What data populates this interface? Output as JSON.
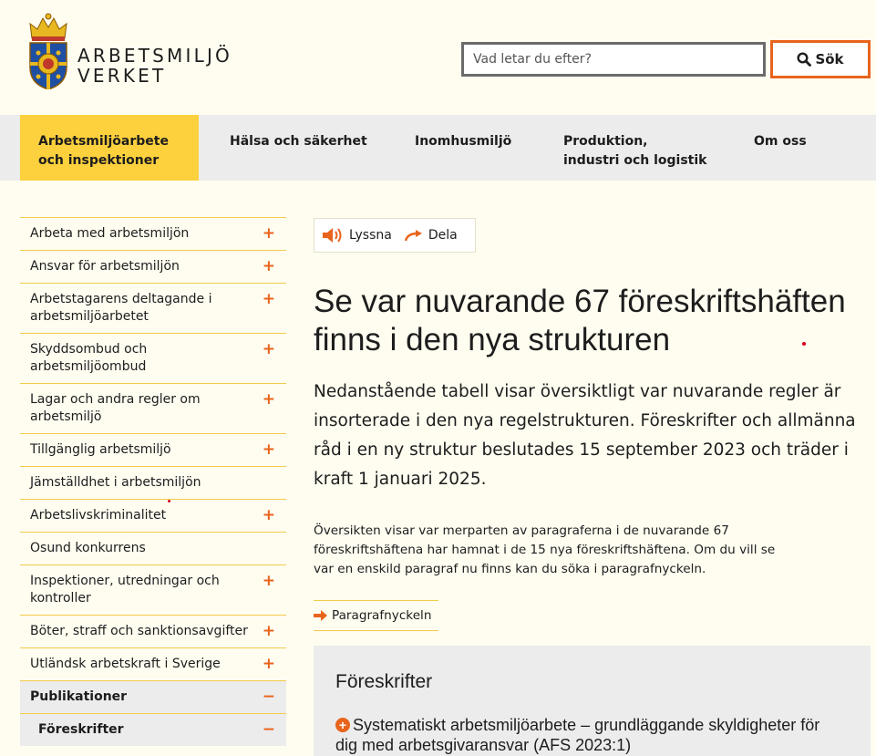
{
  "header": {
    "logo_line1": "ARBETSMILJÖ",
    "logo_line2": "VERKET",
    "search_placeholder": "Vad letar du efter?",
    "search_button": "Sök",
    "search_icon": "magnifier-icon"
  },
  "colors": {
    "accent_orange": "#e8641c",
    "nav_active": "#fcd13d",
    "nav_bg": "#ececec",
    "page_bg": "#fffdf0"
  },
  "nav": [
    {
      "line1": "Arbetsmiljöarbete",
      "line2": "och inspektioner"
    },
    {
      "line1": "Hälsa och säkerhet",
      "line2": ""
    },
    {
      "line1": "Inomhusmiljö",
      "line2": ""
    },
    {
      "line1": "Produktion,",
      "line2": "industri och logistik"
    },
    {
      "line1": "Om oss",
      "line2": ""
    }
  ],
  "sidebar": [
    {
      "label": "Arbeta med arbetsmiljön",
      "sign": "+"
    },
    {
      "label": "Ansvar för arbetsmiljön",
      "sign": "+"
    },
    {
      "label": "Arbetstagarens deltagande i arbetsmiljöarbetet",
      "sign": "+"
    },
    {
      "label": "Skyddsombud och arbetsmiljöombud",
      "sign": "+"
    },
    {
      "label": "Lagar och andra regler om arbetsmiljö",
      "sign": "+"
    },
    {
      "label": "Tillgänglig arbetsmiljö",
      "sign": "+"
    },
    {
      "label": "Jämställdhet i arbetsmiljön",
      "sign": ""
    },
    {
      "label": "Arbetslivskriminalitet",
      "sign": "+"
    },
    {
      "label": "Osund konkurrens",
      "sign": ""
    },
    {
      "label": "Inspektioner, utredningar och kontroller",
      "sign": "+"
    },
    {
      "label": "Böter, straff och sanktionsavgifter",
      "sign": "+"
    },
    {
      "label": "Utländsk arbetskraft i Sverige",
      "sign": "+"
    },
    {
      "label": "Publikationer",
      "sign": "−"
    },
    {
      "label": "Föreskrifter",
      "sign": "−"
    }
  ],
  "tools": {
    "listen": "Lyssna",
    "share": "Dela",
    "listen_icon": "speaker-icon",
    "share_icon": "share-arrow-icon"
  },
  "main": {
    "title": "Se var nuvarande 67 föreskriftshäften finns i den nya strukturen",
    "lead": "Nedanstående tabell visar översiktligt var nuvarande regler är insorterade i den nya regelstrukturen. Föreskrifter och allmänna råd i en ny struktur beslutades 15 september 2023 och träder i kraft 1 januari 2025.",
    "body": "Översikten visar var merparten av paragraferna i de nuvarande 67 föreskriftshäftena har hamnat i de 15 nya föreskriftshäftena. Om du vill se var en enskild paragraf nu finns kan du söka i paragrafnyckeln.",
    "link": "Paragrafnyckeln",
    "panel_title": "Föreskrifter",
    "panel_item": "Systematiskt arbetsmiljöarbete – grundläggande skyldigheter för dig med arbetsgivaransvar (AFS 2023:1)"
  }
}
